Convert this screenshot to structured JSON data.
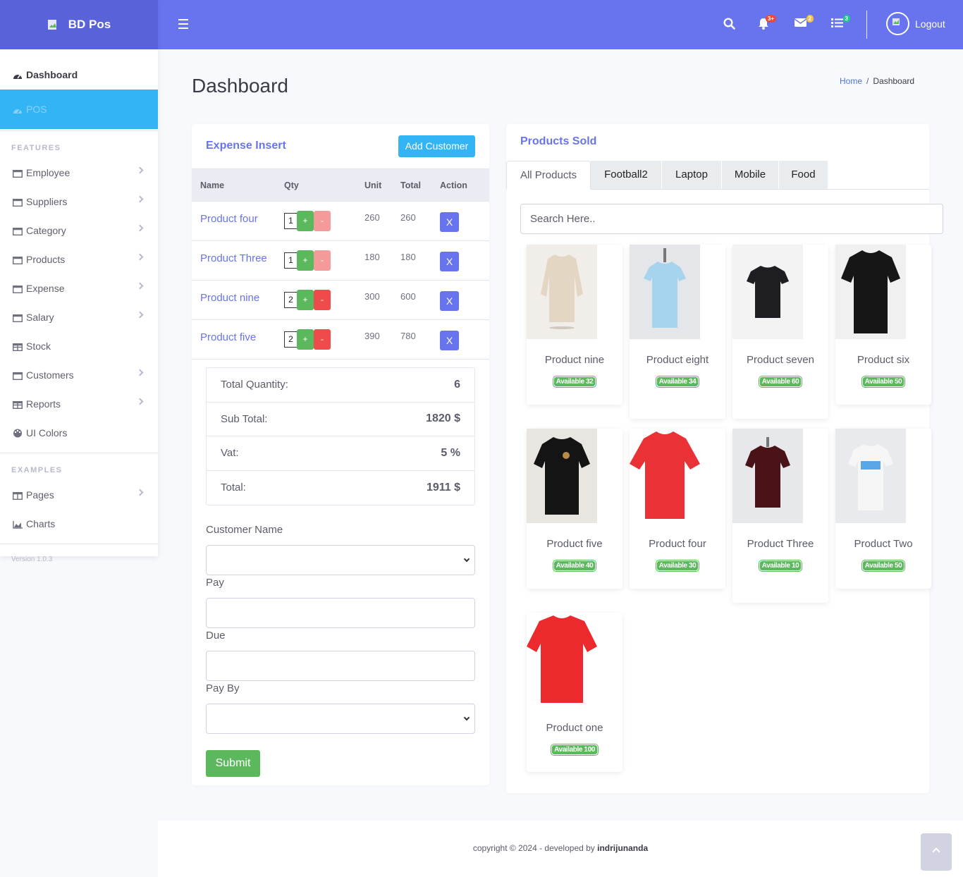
{
  "brand": {
    "name": "BD Pos"
  },
  "topbar": {
    "logout_label": "Logout",
    "alerts_count": "3+",
    "messages_count": "2",
    "tasks_count": "3"
  },
  "sidebar": {
    "dashboard": "Dashboard",
    "pos": "POS",
    "features_heading": "FEATURES",
    "features": [
      "Employee",
      "Suppliers",
      "Category",
      "Products",
      "Expense",
      "Salary",
      "Stock",
      "Customers",
      "Reports",
      "UI Colors"
    ],
    "examples_heading": "EXAMPLES",
    "examples": [
      "Pages",
      "Charts"
    ],
    "version": "Version 1.0.3"
  },
  "page": {
    "title": "Dashboard",
    "breadcrumb_home": "Home",
    "breadcrumb_sep": "/",
    "breadcrumb_current": "Dashboard"
  },
  "expense": {
    "title": "Expense Insert",
    "add_customer": "Add Customer",
    "columns": [
      "Name",
      "Qty",
      "Unit",
      "Total",
      "Action"
    ],
    "rows": [
      {
        "name": "Product four",
        "qty": "1",
        "unit": "260",
        "total": "260"
      },
      {
        "name": "Product Three",
        "qty": "1",
        "unit": "180",
        "total": "180"
      },
      {
        "name": "Product nine",
        "qty": "2",
        "unit": "300",
        "total": "600"
      },
      {
        "name": "Product five",
        "qty": "2",
        "unit": "390",
        "total": "780"
      }
    ],
    "plus": "+",
    "minus": "-",
    "remove": "X",
    "totals": {
      "quantity_label": "Total Quantity:",
      "quantity": "6",
      "subtotal_label": "Sub Total:",
      "subtotal": "1820 $",
      "vat_label": "Vat:",
      "vat": "5 %",
      "total_label": "Total:",
      "total": "1911 $"
    },
    "form": {
      "customer_label": "Customer Name",
      "pay_label": "Pay",
      "due_label": "Due",
      "payby_label": "Pay By",
      "submit": "Submit"
    }
  },
  "products": {
    "title": "Products Sold",
    "tabs": [
      "All Products",
      "Football2",
      "Laptop",
      "Mobile",
      "Food"
    ],
    "search_placeholder": "Search Here..",
    "items": [
      {
        "name": "Product nine",
        "available": "Available 32",
        "shirt_color": "#e3d6c3"
      },
      {
        "name": "Product eight",
        "available": "Available 34",
        "shirt_color": "#a6d4ee"
      },
      {
        "name": "Product seven",
        "available": "Available 60",
        "shirt_color": "#1d1d22"
      },
      {
        "name": "Product six",
        "available": "Available 50",
        "shirt_color": "#161616"
      },
      {
        "name": "Product five",
        "available": "Available 40",
        "shirt_color": "#141414"
      },
      {
        "name": "Product four",
        "available": "Available 30",
        "shirt_color": "#ea3236"
      },
      {
        "name": "Product Three",
        "available": "Available 10",
        "shirt_color": "#4a1318"
      },
      {
        "name": "Product Two",
        "available": "Available 50",
        "shirt_color": "#f6f6f6"
      },
      {
        "name": "Product one",
        "available": "Available 100",
        "shirt_color": "#ec2a2e"
      }
    ]
  },
  "footer": {
    "text": "copyright © 2024 - developed by",
    "author": "indrijunanda"
  },
  "colors": {
    "primary": "#6874ee",
    "sidebar_brand": "#5a62d9",
    "active_nav": "#33b5f5",
    "success": "#5cb85c",
    "danger": "#f04b4b"
  }
}
